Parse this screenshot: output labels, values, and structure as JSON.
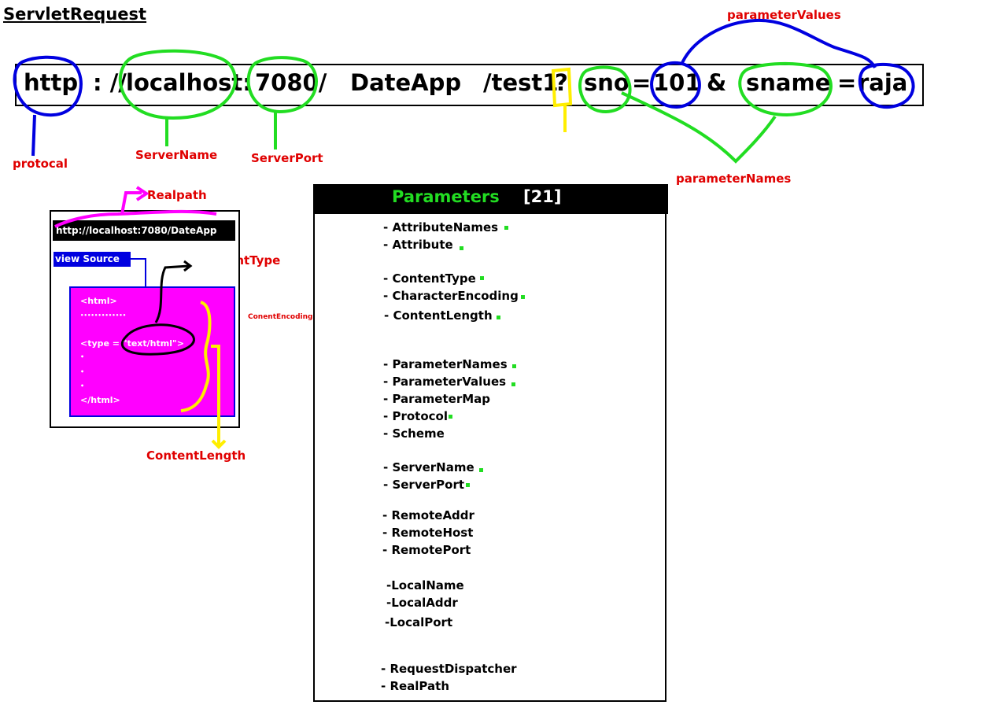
{
  "title": "ServletRequest",
  "url": {
    "protocol": "http",
    "sep1": ": //",
    "host": "localhost:",
    "port": "7080/",
    "app": "DateApp",
    "path": "/test1",
    "qmark": "?",
    "name1": "sno",
    "eq1": "=",
    "value1": "101",
    "amp": "&",
    "name2": "sname",
    "eq2": "=",
    "value2": "raja"
  },
  "labels": {
    "parameterValues": "parameterValues",
    "protocol": "protocal",
    "serverName": "ServerName",
    "serverPort": "ServerPort",
    "parameterNames": "parameterNames",
    "realpath": "Realpath",
    "contentType": "ContentType",
    "contentEncoding": "ConentEncoding",
    "contentLength": "ContentLength"
  },
  "browser": {
    "address": "http://localhost:7080/DateApp",
    "view_source": "view Source",
    "source_lines": [
      "<html>",
      "•••••••••••••",
      "<type = \"text/html\">",
      "•",
      "•",
      "•",
      "</html>"
    ]
  },
  "parameters": {
    "heading": "Parameters",
    "count": "[21]",
    "items": [
      "- AttributeNames",
      "- Attribute",
      "- ContentType",
      "- CharacterEncoding",
      "- ContentLength",
      "- ParameterNames",
      "- ParameterValues",
      "- ParameterMap",
      "- Protocol",
      "- Scheme",
      "- ServerName",
      "- ServerPort",
      "- RemoteAddr",
      "- RemoteHost",
      "- RemotePort",
      "-LocalName",
      "-LocalAddr",
      "-LocalPort",
      "- RequestDispatcher",
      "- RealPath"
    ]
  },
  "colors": {
    "blue": "#0000e0",
    "green": "#22dd22",
    "yellow": "#ffee00",
    "magenta": "#ff00ff",
    "red": "#e00000",
    "black": "#000000"
  }
}
